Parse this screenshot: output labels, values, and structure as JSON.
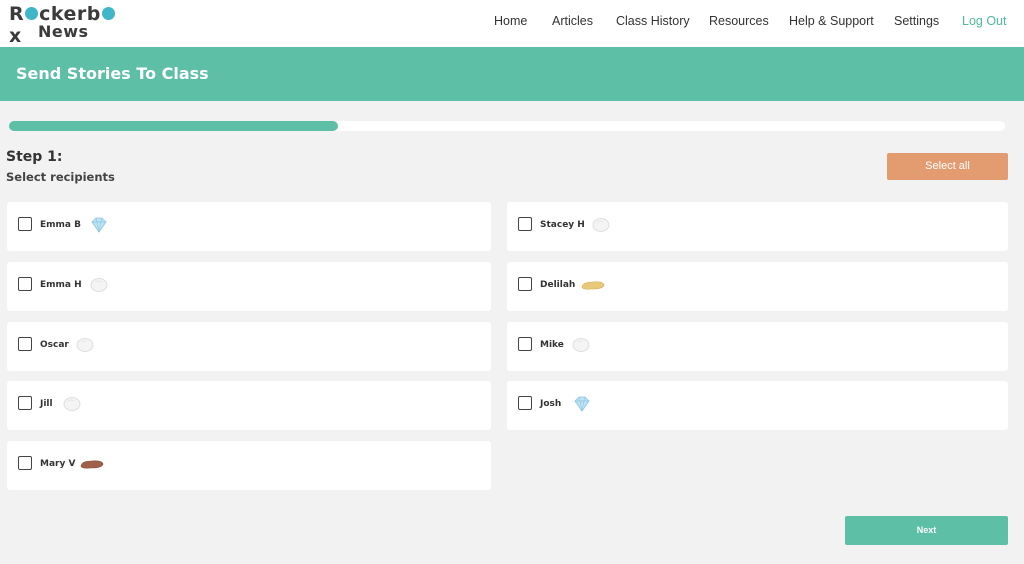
{
  "brand": {
    "logo_line1_a": "R",
    "logo_line1_b": "ckerb",
    "logo_line1_c": "x",
    "logo_line2": "News",
    "accent_color": "#5dbfa6",
    "logo_dot_color": "#3fb7c9"
  },
  "nav": {
    "items": [
      {
        "label": "Home"
      },
      {
        "label": "Articles"
      },
      {
        "label": "Class History"
      },
      {
        "label": "Resources"
      },
      {
        "label": "Help & Support"
      },
      {
        "label": "Settings"
      },
      {
        "label": "Log Out"
      }
    ]
  },
  "banner": {
    "title": "Send Stories To Class",
    "color": "#5dbfa6"
  },
  "progress": {
    "fraction": 0.33
  },
  "step": {
    "title": "Step 1:",
    "subtitle": "Select recipients"
  },
  "actions": {
    "select_all_label": "Select all",
    "select_all_color": "#e39c6f",
    "next_label": "Next"
  },
  "students": [
    {
      "name": "Emma B",
      "badge": "diamond-icon",
      "checked": false
    },
    {
      "name": "Stacey H",
      "badge": "silver-cloud-icon",
      "checked": false
    },
    {
      "name": "Emma H",
      "badge": "silver-cloud-icon",
      "checked": false
    },
    {
      "name": "Delilah",
      "badge": "gold-bar-icon",
      "checked": false
    },
    {
      "name": "Oscar",
      "badge": "silver-cloud-icon",
      "checked": false
    },
    {
      "name": "Mike",
      "badge": "silver-cloud-icon",
      "checked": false
    },
    {
      "name": "Jill",
      "badge": "silver-cloud-icon",
      "checked": false
    },
    {
      "name": "Josh",
      "badge": "diamond-icon",
      "checked": false
    },
    {
      "name": "Mary V",
      "badge": "bronze-bar-icon",
      "checked": false
    }
  ]
}
